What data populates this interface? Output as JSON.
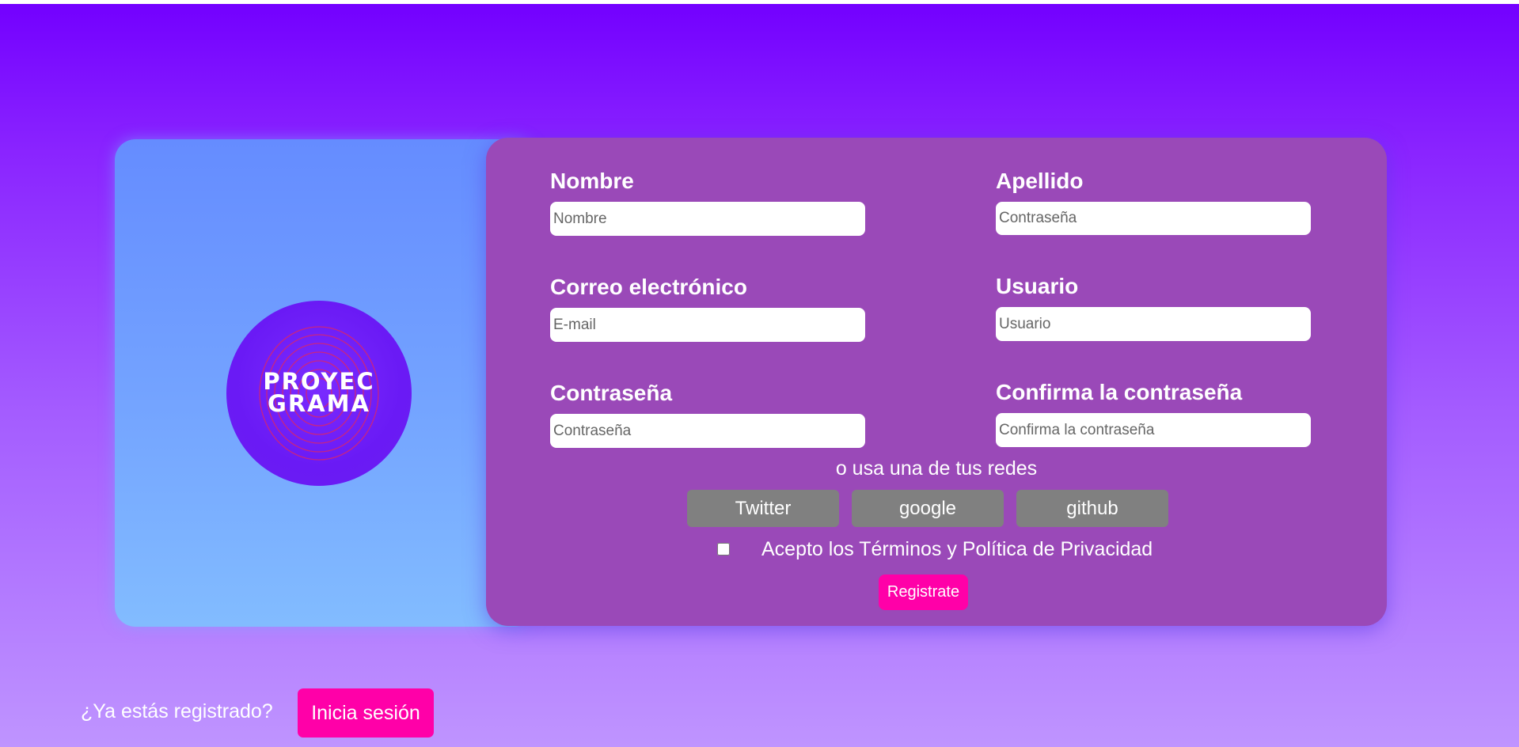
{
  "logo": {
    "line1": "PROYEC",
    "line2": "GRAMA"
  },
  "form": {
    "fields": [
      {
        "label": "Nombre",
        "placeholder": "Nombre"
      },
      {
        "label": "Apellido",
        "placeholder": "Contraseña"
      },
      {
        "label": "Correo electrónico",
        "placeholder": "E-mail"
      },
      {
        "label": "Usuario",
        "placeholder": "Usuario"
      },
      {
        "label": "Contraseña",
        "placeholder": "Contraseña"
      },
      {
        "label": "Confirma la contraseña",
        "placeholder": "Confirma la contraseña"
      }
    ],
    "social_text": "o usa una de tus redes",
    "social_buttons": [
      "Twitter",
      "google",
      "github"
    ],
    "terms_label": "Acepto los Términos y Política de Privacidad",
    "terms_checked": false,
    "register_label": "Registrate"
  },
  "footer": {
    "question": "¿Ya estás registrado?",
    "login_label": "Inicia sesión"
  },
  "colors": {
    "form_card": "#9a49b8",
    "accent_button": "#ff00a8",
    "social_button": "#808080",
    "background_top": "#7300ff",
    "background_bottom": "#bf94ff"
  }
}
